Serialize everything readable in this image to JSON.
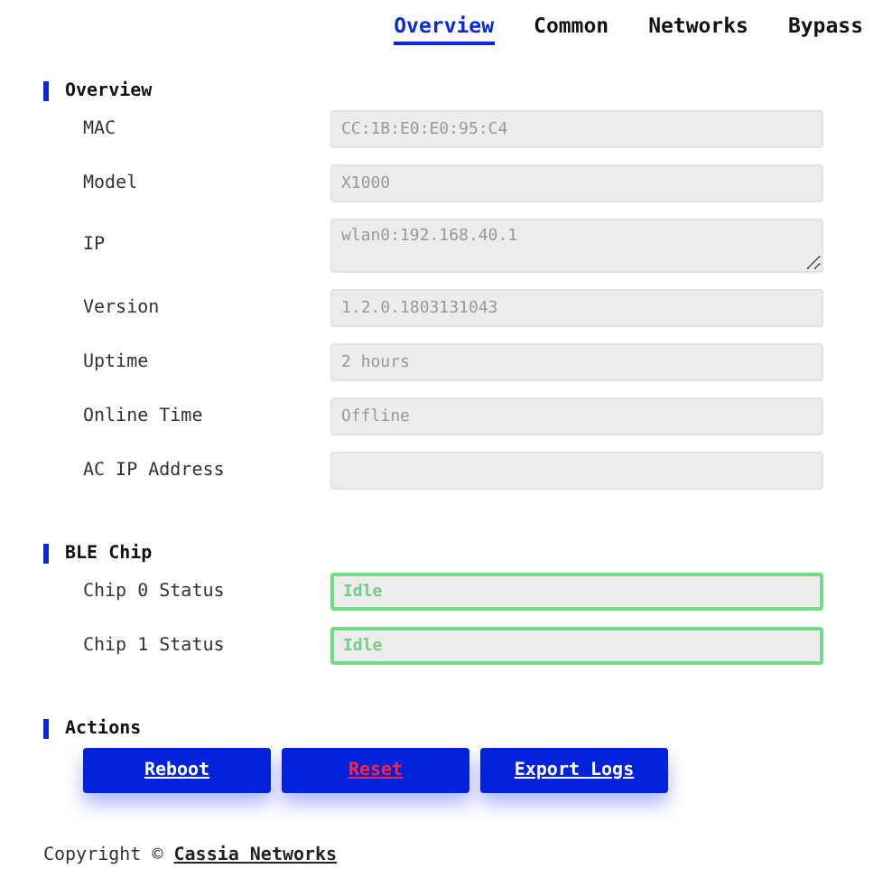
{
  "tabs": [
    {
      "label": "Overview",
      "selected": true
    },
    {
      "label": "Common",
      "selected": false
    },
    {
      "label": "Networks",
      "selected": false
    },
    {
      "label": "Bypass",
      "selected": false
    }
  ],
  "sections": [
    {
      "title": "Overview",
      "fields": [
        {
          "label": "MAC",
          "value": "CC:1B:E0:E0:95:C4",
          "kind": "input"
        },
        {
          "label": "Model",
          "value": "X1000",
          "kind": "input"
        },
        {
          "label": "IP",
          "value": "wlan0:192.168.40.1",
          "kind": "textarea"
        },
        {
          "label": "Version",
          "value": "1.2.0.1803131043",
          "kind": "input"
        },
        {
          "label": "Uptime",
          "value": "2 hours",
          "kind": "input"
        },
        {
          "label": "Online Time",
          "value": "Offline",
          "kind": "input"
        },
        {
          "label": "AC IP Address",
          "kind": "input"
        }
      ]
    },
    {
      "title": "BLE Chip",
      "fields": [
        {
          "label": "Chip 0 Status",
          "value": "Idle",
          "kind": "status"
        },
        {
          "label": "Chip 1 Status",
          "value": "Idle",
          "kind": "status"
        }
      ]
    },
    {
      "title": "Actions",
      "buttons": [
        {
          "label": "Reboot",
          "kind": "normal"
        },
        {
          "label": "Reset",
          "kind": "danger"
        },
        {
          "label": "Export Logs",
          "kind": "normal"
        }
      ]
    }
  ],
  "footer": {
    "text": "Copyright ©",
    "link": "Cassia Networks"
  }
}
